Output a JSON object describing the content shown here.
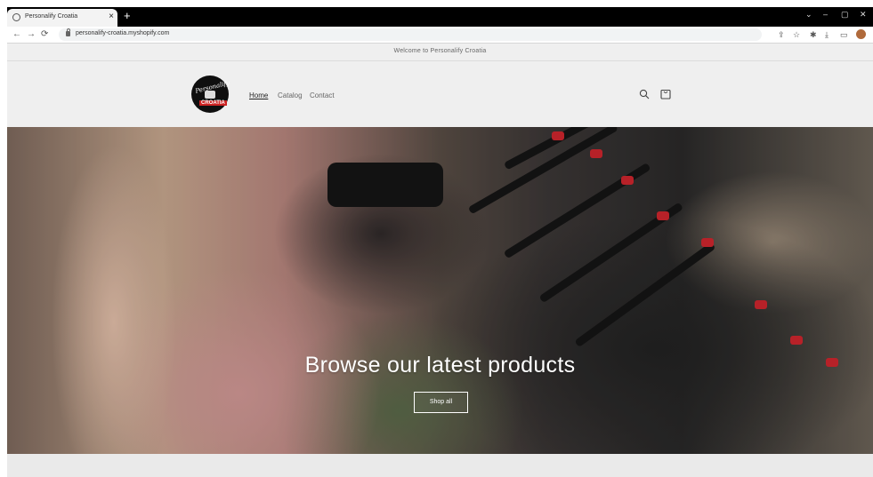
{
  "browser": {
    "tab_title": "Personalify Croatia",
    "tab_close": "×",
    "new_tab": "+",
    "url": "personalify-croatia.myshopify.com",
    "window_controls": [
      "⌄",
      "–",
      "▢",
      "✕"
    ]
  },
  "announcement": {
    "text": "Welcome to Personalify Croatia"
  },
  "header": {
    "logo_text_top": "Personalify",
    "logo_text_bottom": "CROATIA",
    "nav": [
      {
        "label": "Home",
        "active": true
      },
      {
        "label": "Catalog",
        "active": false
      },
      {
        "label": "Contact",
        "active": false
      }
    ],
    "icons": [
      "search-icon",
      "cart-icon"
    ]
  },
  "hero": {
    "headline": "Browse our latest products",
    "button_label": "Shop all"
  },
  "colors": {
    "page_bg": "#efefef",
    "text": "#222222",
    "tab_strip": "#000000",
    "tag_red": "#d1262e"
  }
}
